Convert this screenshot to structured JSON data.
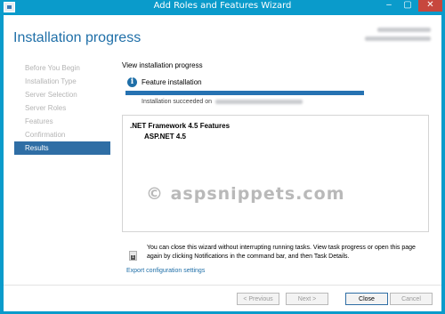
{
  "window": {
    "title": "Add Roles and Features Wizard",
    "min_label": "–",
    "max_label": "▢",
    "close_label": "✕"
  },
  "header": {
    "page_title": "Installation progress"
  },
  "nav": {
    "items": [
      {
        "label": "Before You Begin",
        "active": false
      },
      {
        "label": "Installation Type",
        "active": false
      },
      {
        "label": "Server Selection",
        "active": false
      },
      {
        "label": "Server Roles",
        "active": false
      },
      {
        "label": "Features",
        "active": false
      },
      {
        "label": "Confirmation",
        "active": false
      },
      {
        "label": "Results",
        "active": true
      }
    ]
  },
  "content": {
    "subheading": "View installation progress",
    "feature_label": "Feature installation",
    "success_prefix": "Installation succeeded on",
    "progress": 1.0,
    "results": {
      "line1": ".NET Framework 4.5 Features",
      "line2": "ASP.NET 4.5"
    },
    "note": "You can close this wizard without interrupting running tasks. View task progress or open this page again by clicking Notifications in the command bar, and then Task Details.",
    "export_link": "Export configuration settings"
  },
  "watermark": "© aspsnippets.com",
  "footer": {
    "previous": "< Previous",
    "next": "Next >",
    "close": "Close",
    "cancel": "Cancel"
  },
  "colors": {
    "title_bar": "#0a9bcb",
    "accent": "#1f6fa8",
    "progress": "#2672b2",
    "nav_active": "#2f6ea5"
  }
}
